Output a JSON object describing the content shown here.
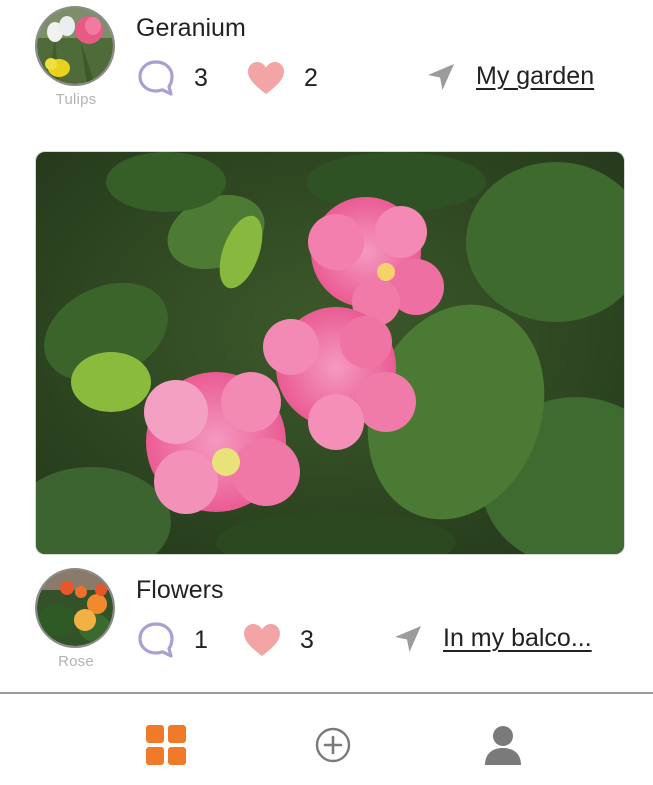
{
  "posts": [
    {
      "title": "Geranium",
      "avatar_caption": "Tulips",
      "comments": "3",
      "likes": "2",
      "location": "My garden"
    },
    {
      "title": "Flowers",
      "avatar_caption": "Rose",
      "comments": "1",
      "likes": "3",
      "location": "In my balco..."
    }
  ],
  "icons": {
    "comment": "comment-bubble-icon",
    "like": "heart-icon",
    "location": "location-arrow-icon",
    "feed_tab": "grid-icon",
    "add_tab": "plus-circle-icon",
    "profile_tab": "person-icon"
  },
  "colors": {
    "accent": "#f07a2a",
    "comment_icon": "#a8a0d2",
    "like_icon": "#f3a5a5",
    "location_icon": "#9b9b9b",
    "inactive_tab": "#7a7a7a"
  },
  "tabbar": {
    "active_tab": "feed"
  }
}
